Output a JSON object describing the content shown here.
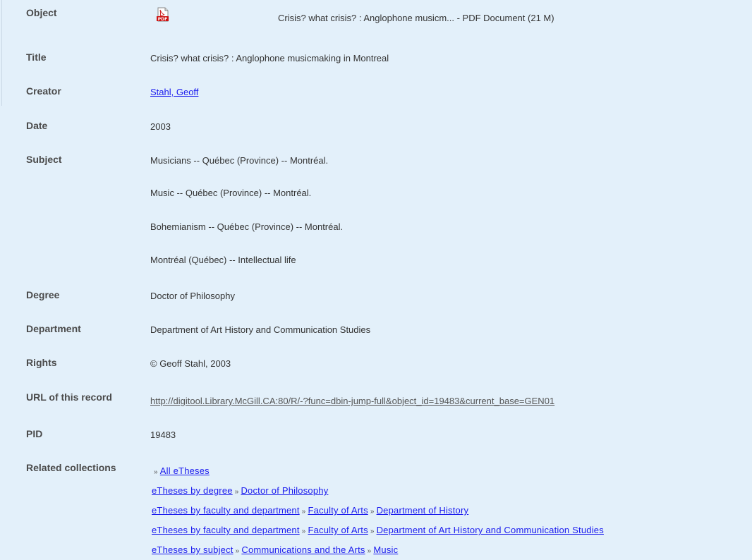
{
  "object": {
    "label": "Object",
    "pdf_icon": "pdf-file-icon",
    "description": "Crisis? what crisis? : Anglophone musicm... - PDF Document (21 M)"
  },
  "title": {
    "label": "Title",
    "value": "Crisis? what crisis? : Anglophone musicmaking in Montreal"
  },
  "creator": {
    "label": "Creator",
    "value": "Stahl, Geoff"
  },
  "date": {
    "label": "Date",
    "value": "2003"
  },
  "subject": {
    "label": "Subject",
    "items": [
      "Musicians -- Québec (Province) -- Montréal.",
      "Music -- Québec (Province) -- Montréal.",
      "Bohemianism -- Québec (Province) -- Montréal.",
      "Montréal (Québec) -- Intellectual life"
    ]
  },
  "degree": {
    "label": "Degree",
    "value": "Doctor of Philosophy"
  },
  "department": {
    "label": "Department",
    "value": "Department of Art History and Communication Studies"
  },
  "rights": {
    "label": "Rights",
    "value": "© Geoff Stahl, 2003"
  },
  "url": {
    "label": "URL of this record",
    "value": "http://digitool.Library.McGill.CA:80/R/-?func=dbin-jump-full&object_id=19483&current_base=GEN01"
  },
  "pid": {
    "label": "PID",
    "value": "19483"
  },
  "related": {
    "label": "Related collections",
    "separator": "»",
    "lines": [
      [
        "All eTheses"
      ],
      [
        "eTheses by degree",
        "Doctor of Philosophy"
      ],
      [
        "eTheses by faculty and department",
        "Faculty of Arts",
        "Department of History"
      ],
      [
        "eTheses by faculty and department",
        "Faculty of Arts",
        "Department of Art History and Communication Studies"
      ],
      [
        "eTheses by subject",
        "Communications and the Arts",
        "Music"
      ]
    ]
  },
  "colors": {
    "background": "#e3f0fa",
    "link": "#1a1aee",
    "label": "#4a4a4a",
    "text": "#333333"
  }
}
